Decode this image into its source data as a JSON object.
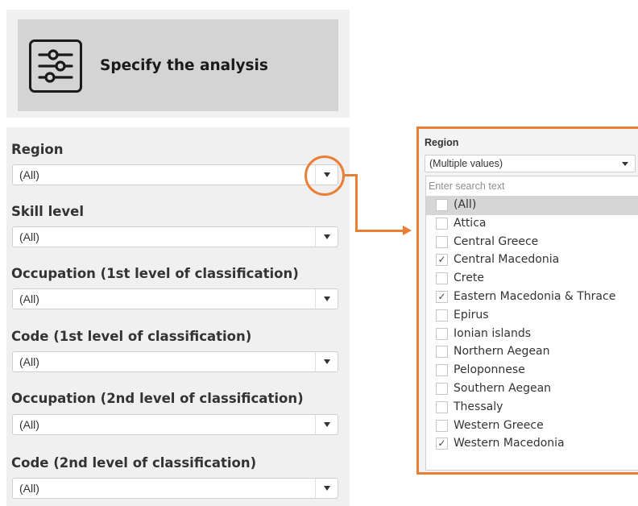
{
  "header": {
    "title": "Specify the analysis",
    "icon": "sliders-icon"
  },
  "filters": [
    {
      "label": "Region",
      "value": "(All)"
    },
    {
      "label": "Skill level",
      "value": "(All)"
    },
    {
      "label": "Occupation (1st level of classification)",
      "value": "(All)"
    },
    {
      "label": "Code (1st level of classification)",
      "value": "(All)"
    },
    {
      "label": "Occupation (2nd level of classification)",
      "value": "(All)"
    },
    {
      "label": "Code (2nd level of classification)",
      "value": "(All)"
    }
  ],
  "popup": {
    "label": "Region",
    "selected_value": "(Multiple values)",
    "search_placeholder": "Enter search text",
    "options": [
      {
        "label": "(All)",
        "checked": false,
        "hovered": true
      },
      {
        "label": "Attica",
        "checked": false
      },
      {
        "label": "Central Greece",
        "checked": false
      },
      {
        "label": "Central Macedonia",
        "checked": true
      },
      {
        "label": "Crete",
        "checked": false
      },
      {
        "label": "Eastern Macedonia & Thrace",
        "checked": true
      },
      {
        "label": "Epirus",
        "checked": false
      },
      {
        "label": "Ionian islands",
        "checked": false
      },
      {
        "label": "Northern Aegean",
        "checked": false
      },
      {
        "label": "Peloponnese",
        "checked": false
      },
      {
        "label": "Southern Aegean",
        "checked": false
      },
      {
        "label": "Thessaly",
        "checked": false
      },
      {
        "label": "Western Greece",
        "checked": false
      },
      {
        "label": "Western Macedonia",
        "checked": true
      }
    ]
  },
  "colors": {
    "accent": "#e97e35",
    "panel_bg": "#f0f0f0",
    "header_bg": "#d4d4d4",
    "text": "#333333"
  }
}
